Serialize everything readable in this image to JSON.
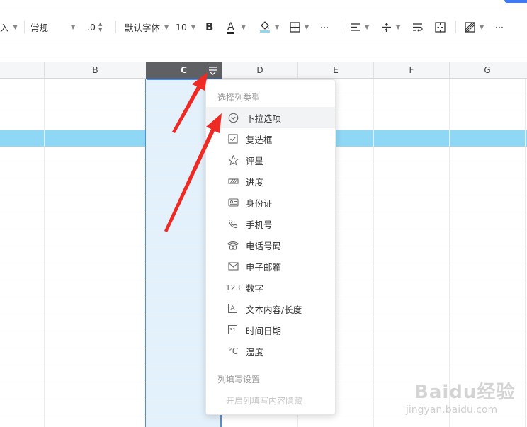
{
  "toolbar": {
    "insert_partial": "入",
    "format_label": "常规",
    "decimal_label": ".0",
    "font_family": "默认字体",
    "font_size": "10",
    "bold_label": "B",
    "font_color_label": "A",
    "more_label": "···",
    "more_label_2": "···"
  },
  "columns": [
    "B",
    "C",
    "D",
    "E",
    "F",
    "G"
  ],
  "selected_column": "C",
  "highlight_row_color": "#8fd8f5",
  "accent_color": "#4a8df0",
  "dropdown": {
    "section_title": "选择列类型",
    "items": [
      {
        "label": "下拉选项",
        "icon": "dropdown-circle-icon"
      },
      {
        "label": "复选框",
        "icon": "checkbox-icon"
      },
      {
        "label": "评星",
        "icon": "star-icon"
      },
      {
        "label": "进度",
        "icon": "progress-icon"
      },
      {
        "label": "身份证",
        "icon": "id-card-icon"
      },
      {
        "label": "手机号",
        "icon": "phone-icon"
      },
      {
        "label": "电话号码",
        "icon": "telephone-icon"
      },
      {
        "label": "电子邮箱",
        "icon": "mail-icon"
      },
      {
        "label": "数字",
        "icon": "number-icon",
        "glyph": "123"
      },
      {
        "label": "文本内容/长度",
        "icon": "text-icon",
        "glyph": "A"
      },
      {
        "label": "时间日期",
        "icon": "calendar-icon",
        "glyph": "31"
      },
      {
        "label": "温度",
        "icon": "temperature-icon",
        "glyph": "°C"
      }
    ],
    "section2_title": "列填写设置",
    "disabled_option": "开启列填写内容隐藏"
  },
  "watermark": {
    "text": "Baidu经验",
    "sub": "jingyan.baidu.com"
  }
}
